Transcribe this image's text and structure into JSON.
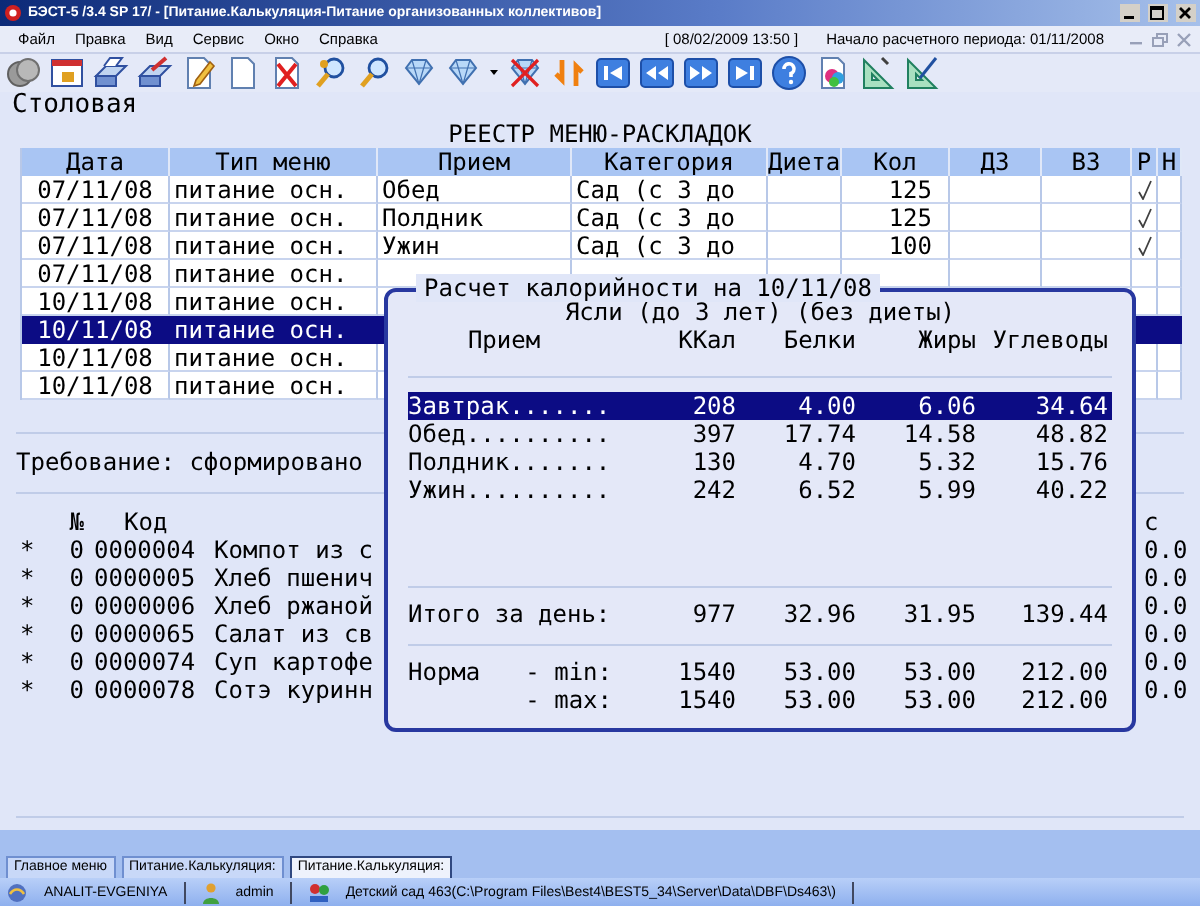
{
  "window": {
    "title": "БЭСТ-5 /3.4 SP 17/ - [Питание.Калькуляция-Питание организованных коллективов]"
  },
  "menu": [
    "Файл",
    "Правка",
    "Вид",
    "Сервис",
    "Окно",
    "Справка"
  ],
  "menu_info": {
    "datetime": "[ 08/02/2009 13:50 ]",
    "period": "Начало расчетного периода: 01/11/2008"
  },
  "section": "Столовая",
  "registry": {
    "title": "РЕЕСТР МЕНЮ-РАСКЛАДОК",
    "columns": [
      "Дата",
      "Тип меню",
      "Прием",
      "Категория",
      "Диета",
      "Кол",
      "ДЗ",
      "ВЗ",
      "Р",
      "Н"
    ],
    "rows": [
      {
        "date": "07/11/08",
        "menu_type": "питание осн.",
        "meal": "Обед",
        "category": "Сад (с 3 до",
        "count": "125",
        "checked": true,
        "selected": false
      },
      {
        "date": "07/11/08",
        "menu_type": "питание осн.",
        "meal": "Полдник",
        "category": "Сад (с 3 до",
        "count": "125",
        "checked": true,
        "selected": false
      },
      {
        "date": "07/11/08",
        "menu_type": "питание осн.",
        "meal": "Ужин",
        "category": "Сад (с 3 до",
        "count": "100",
        "checked": true,
        "selected": false
      },
      {
        "date": "07/11/08",
        "menu_type": "питание осн.",
        "checked": false,
        "selected": false
      },
      {
        "date": "10/11/08",
        "menu_type": "питание осн.",
        "checked": false,
        "selected": false
      },
      {
        "date": "10/11/08",
        "menu_type": "питание осн.",
        "checked": false,
        "selected": true
      },
      {
        "date": "10/11/08",
        "menu_type": "питание осн.",
        "checked": false,
        "selected": false
      },
      {
        "date": "10/11/08",
        "menu_type": "питание осн.",
        "checked": false,
        "selected": false
      }
    ]
  },
  "requirement": {
    "text": "Требование: сформировано",
    "columns": [
      "№",
      "Код",
      "с"
    ],
    "items": [
      {
        "mark": "*",
        "number": "0",
        "code": "0000004",
        "name": "Компот из с",
        "value": "0.0"
      },
      {
        "mark": "*",
        "number": "0",
        "code": "0000005",
        "name": "Хлеб пшенич",
        "value": "0.0"
      },
      {
        "mark": "*",
        "number": "0",
        "code": "0000006",
        "name": "Хлеб ржаной",
        "value": "0.0"
      },
      {
        "mark": "*",
        "number": "0",
        "code": "0000065",
        "name": "Салат из св",
        "value": "0.0"
      },
      {
        "mark": "*",
        "number": "0",
        "code": "0000074",
        "name": "Суп картофе",
        "value": "0.0"
      },
      {
        "mark": "*",
        "number": "0",
        "code": "0000078",
        "name": "Сотэ куринн",
        "value": "0.0"
      }
    ]
  },
  "calories": {
    "title": "Расчет калорийности на 10/11/08",
    "subtitle": "Ясли (до 3 лет) (без диеты)",
    "columns": [
      "Прием",
      "ККал",
      "Белки",
      "Жиры",
      "Углеводы"
    ],
    "meals": [
      {
        "name": "Завтрак.......",
        "kcal": "208",
        "protein": "4.00",
        "fat": "6.06",
        "carbs": "34.64",
        "selected": true
      },
      {
        "name": "Обед..........",
        "kcal": "397",
        "protein": "17.74",
        "fat": "14.58",
        "carbs": "48.82",
        "selected": false
      },
      {
        "name": "Полдник.......",
        "kcal": "130",
        "protein": "4.70",
        "fat": "5.32",
        "carbs": "15.76",
        "selected": false
      },
      {
        "name": "Ужин..........",
        "kcal": "242",
        "protein": "6.52",
        "fat": "5.99",
        "carbs": "40.22",
        "selected": false
      }
    ],
    "total": {
      "label": "Итого за день:",
      "kcal": "977",
      "protein": "32.96",
      "fat": "31.95",
      "carbs": "139.44"
    },
    "norms": [
      {
        "label": "Норма",
        "bound": "- min:",
        "kcal": "1540",
        "protein": "53.00",
        "fat": "53.00",
        "carbs": "212.00"
      },
      {
        "bound": "- max:",
        "kcal": "1540",
        "protein": "53.00",
        "fat": "53.00",
        "carbs": "212.00"
      }
    ]
  },
  "tabs": [
    {
      "label": "Главное меню",
      "selected": false
    },
    {
      "label": "Питание.Калькуляция:",
      "selected": false
    },
    {
      "label": "Питание.Калькуляция:",
      "selected": true
    }
  ],
  "status_bar": {
    "computer": "ANALIT-EVGENIYA",
    "user": "admin",
    "database": "Детский сад 463(C:\\Program Files\\Best4\\BEST5_34\\Server\\Data\\DBF\\Ds463\\)"
  }
}
